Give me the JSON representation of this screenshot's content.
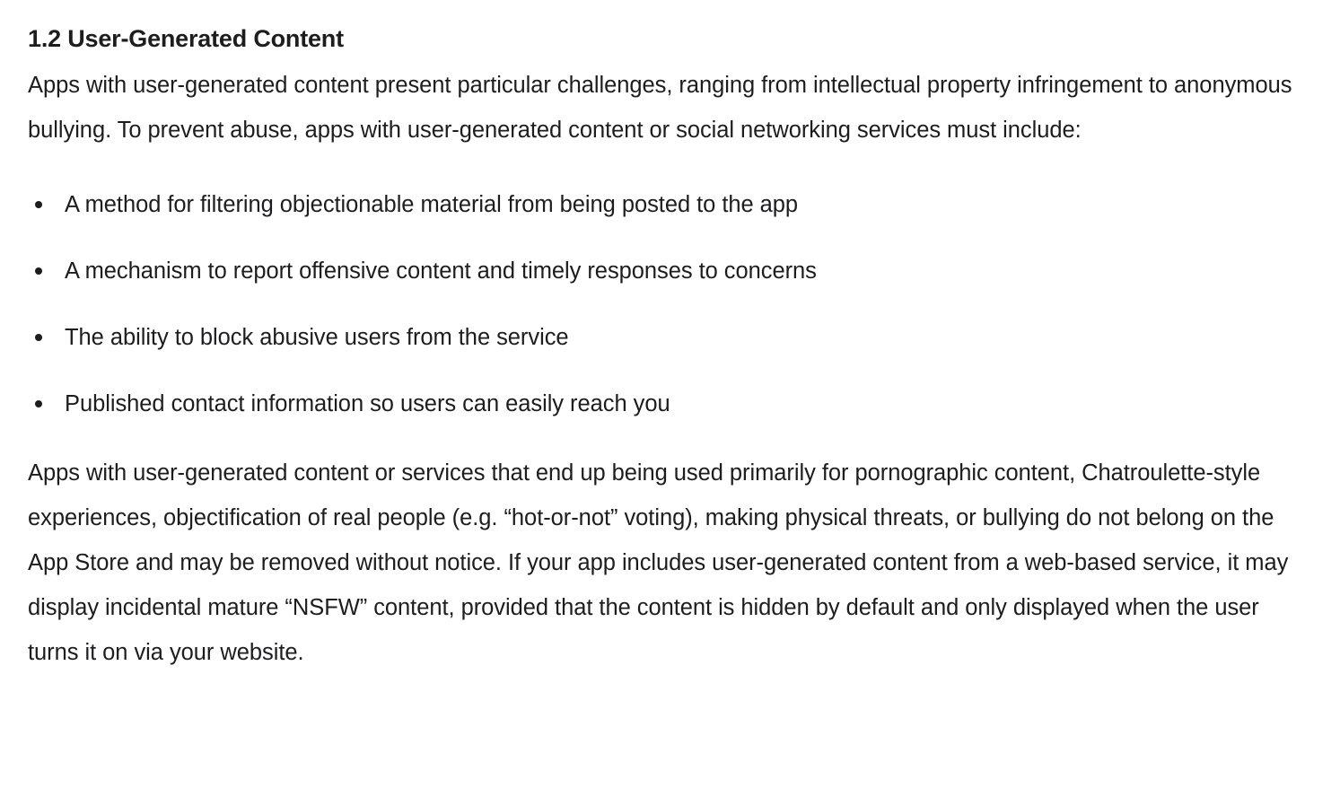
{
  "theme": {
    "background": "#ffffff",
    "text_color": "#1d1d1f",
    "bullet_color": "#1d1d1f"
  },
  "document": {
    "section": {
      "heading": "1.2 User-Generated Content",
      "intro_paragraph": "Apps with user-generated content present particular challenges, ranging from intellectual property infringement to anonymous bullying. To prevent abuse, apps with user-generated content or social networking services must include:",
      "requirements": [
        "A method for filtering objectionable material from being posted to the app",
        "A mechanism to report offensive content and timely responses to concerns",
        "The ability to block abusive users from the service",
        "Published contact information so users can easily reach you"
      ],
      "closing_paragraph": "Apps with user-generated content or services that end up being used primarily for pornographic content, Chatroulette-style experiences, objectification of real people (e.g. “hot-or-not” voting), making physical threats, or bullying do not belong on the App Store and may be removed without notice. If your app includes user-generated content from a web-based service, it may display incidental mature “NSFW” content, provided that the content is hidden by default and only displayed when the user turns it on via your website."
    }
  }
}
